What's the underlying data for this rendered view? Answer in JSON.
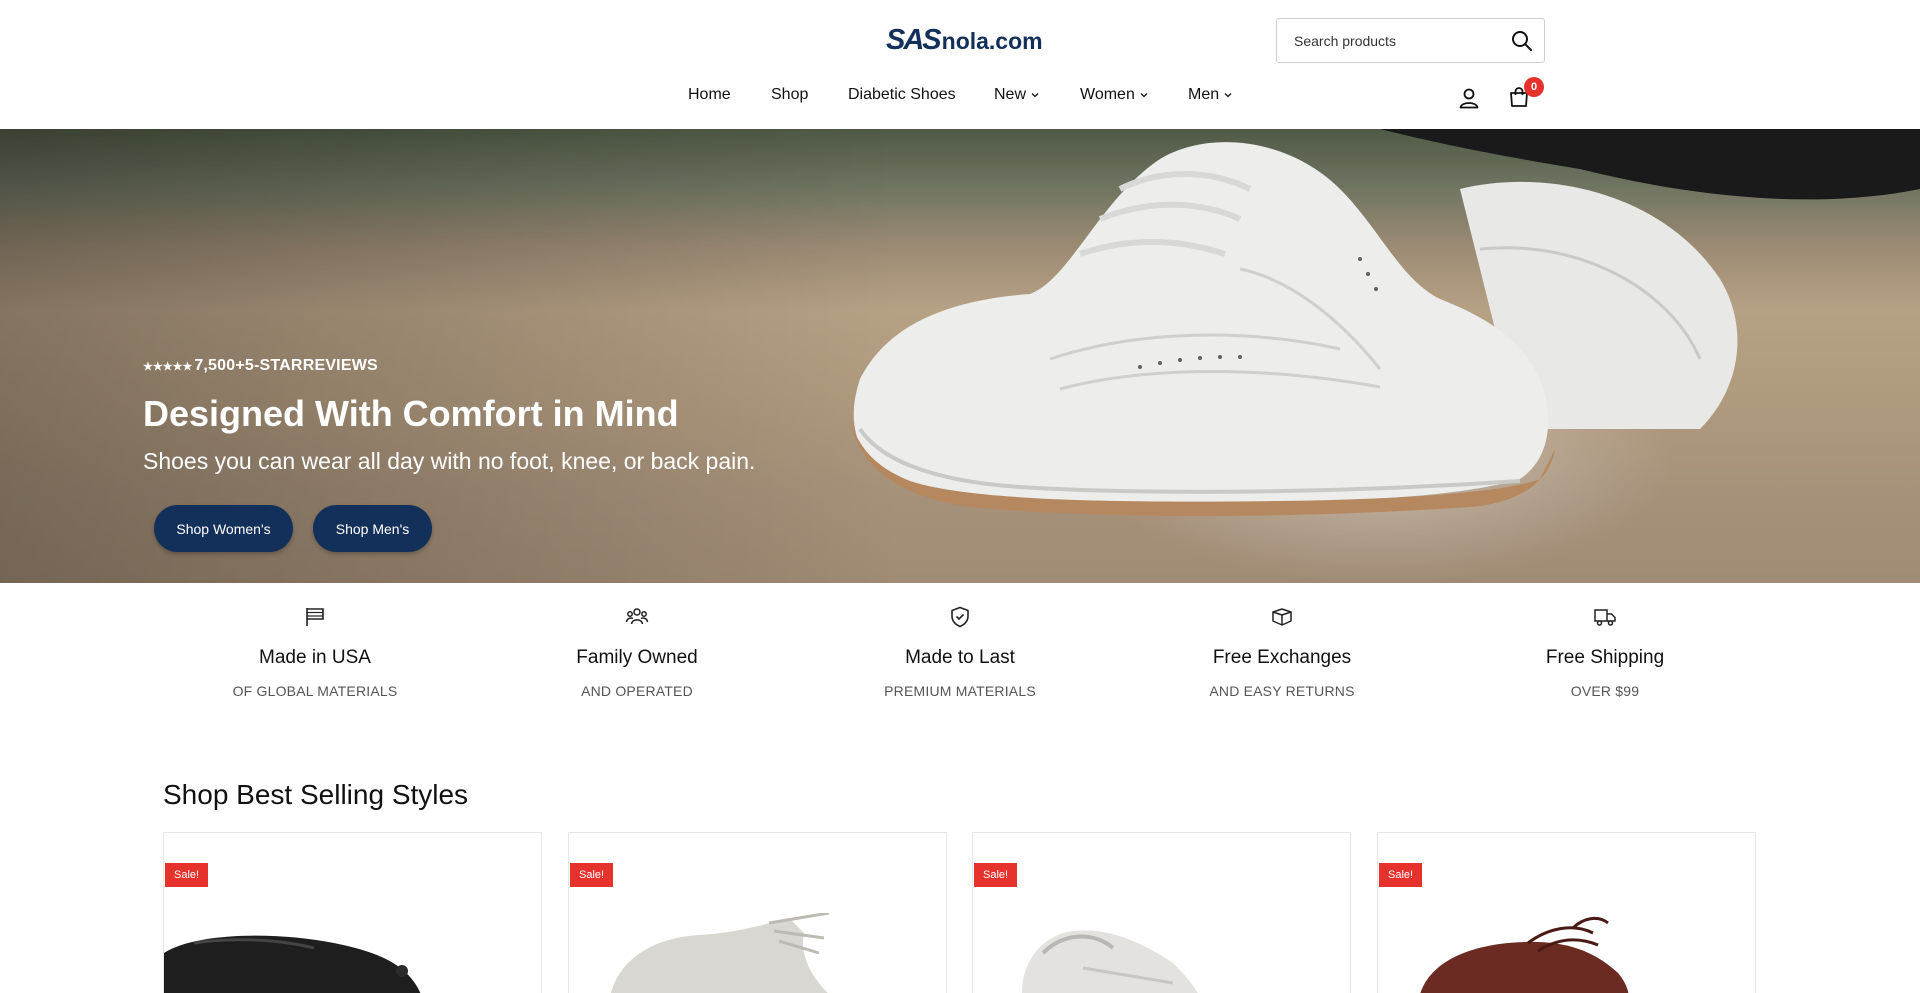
{
  "brand": {
    "logo_mark": "SAS",
    "logo_text": "nola.com"
  },
  "search": {
    "placeholder": "Search products",
    "icon": "search-icon"
  },
  "nav": {
    "items": [
      {
        "label": "Home",
        "dropdown": false
      },
      {
        "label": "Shop",
        "dropdown": false
      },
      {
        "label": "Diabetic Shoes",
        "dropdown": false
      },
      {
        "label": "New",
        "dropdown": true
      },
      {
        "label": "Women",
        "dropdown": true
      },
      {
        "label": "Men",
        "dropdown": true
      }
    ]
  },
  "header_icons": {
    "account": "user-icon",
    "cart": "shopping-bag-icon",
    "cart_count": "0"
  },
  "hero": {
    "stars": "★★★★★",
    "reviews": "7,500+5-STARREVIEWS",
    "title": "Designed With Comfort in Mind",
    "subtitle": "Shoes you can wear all day with no foot, knee, or back pain.",
    "btn_women": "Shop Women's",
    "btn_men": "Shop Men's"
  },
  "features": [
    {
      "icon": "flag-icon",
      "title": "Made in USA",
      "sub": "OF GLOBAL MATERIALS"
    },
    {
      "icon": "family-icon",
      "title": "Family Owned",
      "sub": "AND OPERATED"
    },
    {
      "icon": "shield-check-icon",
      "title": "Made to Last",
      "sub": "PREMIUM MATERIALS"
    },
    {
      "icon": "box-icon",
      "title": "Free Exchanges",
      "sub": "AND EASY RETURNS"
    },
    {
      "icon": "truck-icon",
      "title": "Free Shipping",
      "sub": "OVER $99"
    }
  ],
  "best_sellers": {
    "title": "Shop Best Selling Styles",
    "products": [
      {
        "badge": "Sale!",
        "color": "#1e1e1e"
      },
      {
        "badge": "Sale!",
        "color": "#d9d7d2"
      },
      {
        "badge": "Sale!",
        "color": "#e3e2df"
      },
      {
        "badge": "Sale!",
        "color": "#6b2a22"
      }
    ]
  },
  "colors": {
    "brand_navy": "#13305a",
    "sale_red": "#e5322d",
    "badge_red": "#e5322d"
  }
}
